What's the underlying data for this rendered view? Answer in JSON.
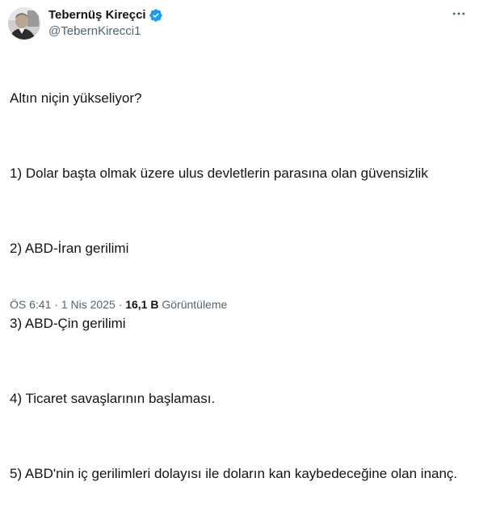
{
  "author": {
    "name": "Tebernüş Kireçci",
    "handle": "@TebernKirecci1",
    "verified_icon": "verified-badge-icon",
    "verified_color": "#1d9bf0"
  },
  "menu": {
    "more_icon": "more-horizontal-icon"
  },
  "tweet": {
    "lines": [
      "Altın niçin yükseliyor?",
      "1) Dolar başta olmak üzere ulus devletlerin parasına olan güvensizlik",
      "2) ABD-İran gerilimi",
      "3) ABD-Çin gerilimi",
      "4) Ticaret savaşlarının başlaması.",
      "5) ABD'nin iç gerilimleri dolayısı ile doların kan kaybedeceğine olan inanç."
    ]
  },
  "meta": {
    "time": "ÖS 6:41",
    "separator": "·",
    "date": "1 Nis 2025",
    "views_count": "16,1 B",
    "views_label": "Görüntüleme"
  },
  "colors": {
    "text_primary": "#0f1419",
    "text_secondary": "#536471"
  }
}
